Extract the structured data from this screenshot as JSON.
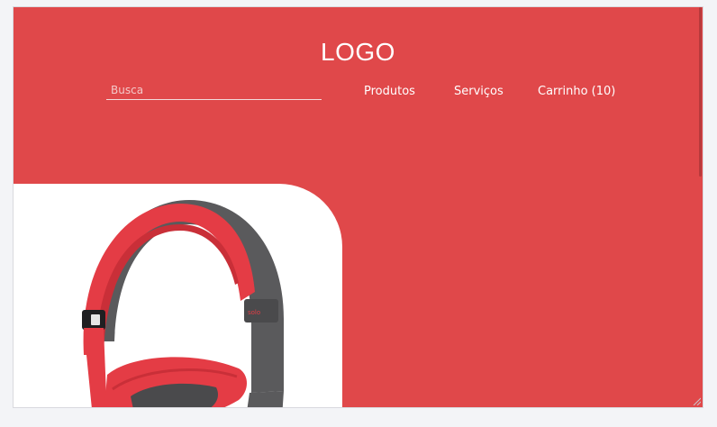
{
  "header": {
    "logo": "LOGO",
    "search_placeholder": "Busca",
    "nav": [
      {
        "label": "Produtos"
      },
      {
        "label": "Serviços"
      },
      {
        "label": "Carrinho (10)"
      }
    ]
  },
  "product": {
    "image": "headphones-icon",
    "brand_tag": "solo"
  },
  "colors": {
    "primary": "#e0484a",
    "card": "#ffffff",
    "headphone_red": "#e43c45",
    "headphone_grey": "#5a5a5c"
  }
}
